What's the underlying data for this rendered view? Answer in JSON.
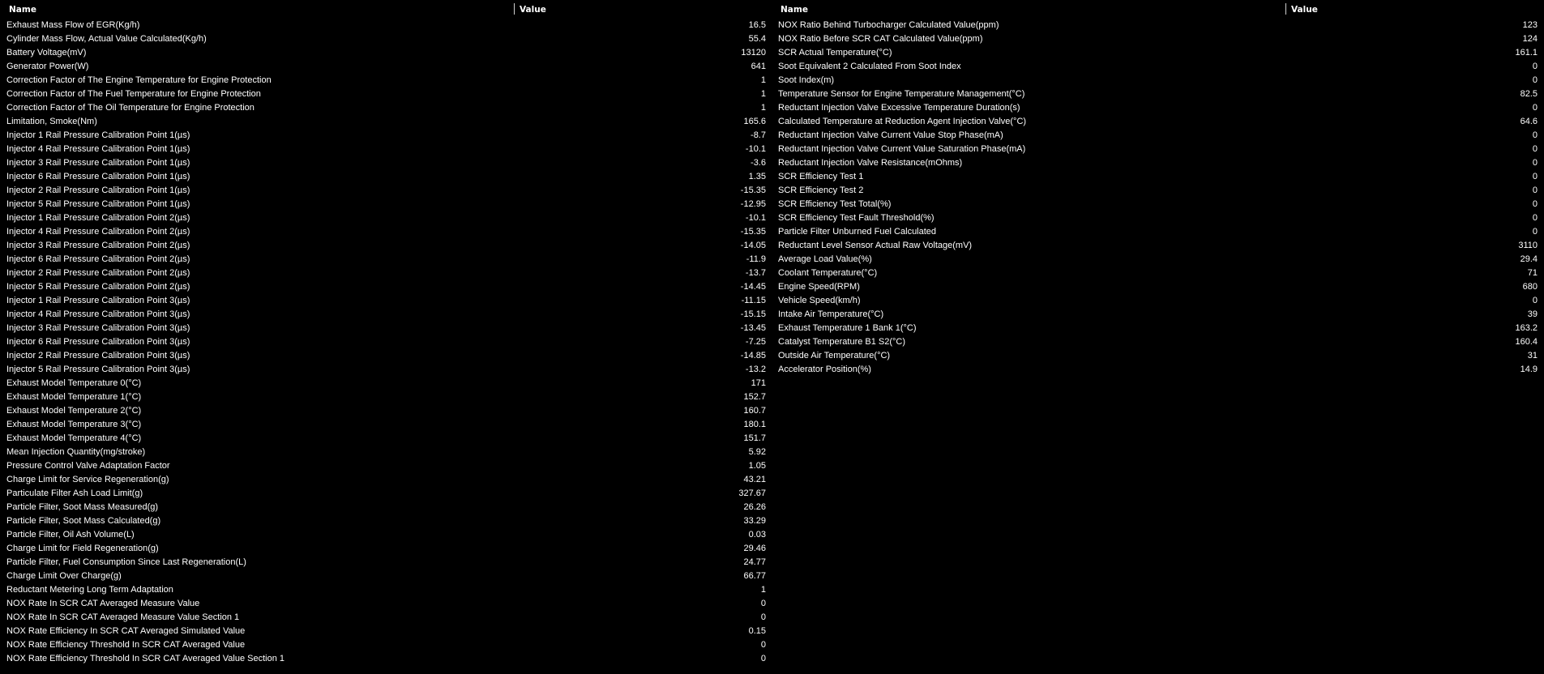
{
  "left_table": {
    "headers": {
      "name": "Name",
      "value": "Value"
    },
    "rows": [
      {
        "name": "Exhaust Mass Flow of EGR(Kg/h)",
        "value": "16.5"
      },
      {
        "name": "Cylinder Mass Flow, Actual Value Calculated(Kg/h)",
        "value": "55.4"
      },
      {
        "name": "Battery Voltage(mV)",
        "value": "13120"
      },
      {
        "name": "Generator Power(W)",
        "value": "641"
      },
      {
        "name": "Correction Factor of The Engine Temperature for Engine Protection",
        "value": "1"
      },
      {
        "name": "Correction Factor of The Fuel Temperature for Engine Protection",
        "value": "1"
      },
      {
        "name": "Correction Factor of The Oil Temperature for Engine Protection",
        "value": "1"
      },
      {
        "name": "Limitation, Smoke(Nm)",
        "value": "165.6"
      },
      {
        "name": "Injector 1 Rail Pressure Calibration Point 1(µs)",
        "value": "-8.7"
      },
      {
        "name": "Injector 4 Rail Pressure Calibration Point 1(µs)",
        "value": "-10.1"
      },
      {
        "name": "Injector 3 Rail Pressure Calibration Point 1(µs)",
        "value": "-3.6"
      },
      {
        "name": "Injector 6 Rail Pressure Calibration Point 1(µs)",
        "value": "1.35"
      },
      {
        "name": "Injector 2 Rail Pressure Calibration Point 1(µs)",
        "value": "-15.35"
      },
      {
        "name": "Injector 5 Rail Pressure Calibration Point 1(µs)",
        "value": "-12.95"
      },
      {
        "name": "Injector 1 Rail Pressure Calibration Point 2(µs)",
        "value": "-10.1"
      },
      {
        "name": "Injector 4 Rail Pressure Calibration Point 2(µs)",
        "value": "-15.35"
      },
      {
        "name": "Injector 3 Rail Pressure Calibration Point 2(µs)",
        "value": "-14.05"
      },
      {
        "name": "Injector 6 Rail Pressure Calibration Point 2(µs)",
        "value": "-11.9"
      },
      {
        "name": "Injector 2 Rail Pressure Calibration Point 2(µs)",
        "value": "-13.7"
      },
      {
        "name": "Injector 5 Rail Pressure Calibration Point 2(µs)",
        "value": "-14.45"
      },
      {
        "name": "Injector 1 Rail Pressure Calibration Point 3(µs)",
        "value": "-11.15"
      },
      {
        "name": "Injector 4 Rail Pressure Calibration Point 3(µs)",
        "value": "-15.15"
      },
      {
        "name": "Injector 3 Rail Pressure Calibration Point 3(µs)",
        "value": "-13.45"
      },
      {
        "name": "Injector 6 Rail Pressure Calibration Point 3(µs)",
        "value": "-7.25"
      },
      {
        "name": "Injector 2 Rail Pressure Calibration Point 3(µs)",
        "value": "-14.85"
      },
      {
        "name": "Injector 5 Rail Pressure Calibration Point 3(µs)",
        "value": "-13.2"
      },
      {
        "name": "Exhaust Model Temperature 0(°C)",
        "value": "171"
      },
      {
        "name": "Exhaust Model Temperature 1(°C)",
        "value": "152.7"
      },
      {
        "name": "Exhaust Model Temperature 2(°C)",
        "value": "160.7"
      },
      {
        "name": "Exhaust Model Temperature 3(°C)",
        "value": "180.1"
      },
      {
        "name": "Exhaust Model Temperature 4(°C)",
        "value": "151.7"
      },
      {
        "name": "Mean Injection Quantity(mg/stroke)",
        "value": "5.92"
      },
      {
        "name": "Pressure Control Valve Adaptation Factor",
        "value": "1.05"
      },
      {
        "name": "Charge Limit for Service Regeneration(g)",
        "value": "43.21"
      },
      {
        "name": "Particulate Filter Ash Load Limit(g)",
        "value": "327.67"
      },
      {
        "name": "Particle Filter, Soot Mass Measured(g)",
        "value": "26.26"
      },
      {
        "name": "Particle Filter, Soot Mass Calculated(g)",
        "value": "33.29"
      },
      {
        "name": "Particle Filter, Oil Ash Volume(L)",
        "value": "0.03"
      },
      {
        "name": "Charge Limit for Field Regeneration(g)",
        "value": "29.46"
      },
      {
        "name": "Particle Filter, Fuel Consumption Since Last Regeneration(L)",
        "value": "24.77"
      },
      {
        "name": "Charge Limit Over Charge(g)",
        "value": "66.77"
      },
      {
        "name": "Reductant Metering Long Term Adaptation",
        "value": "1"
      },
      {
        "name": "NOX Rate In SCR CAT Averaged Measure Value",
        "value": "0"
      },
      {
        "name": "NOX Rate In SCR CAT Averaged Measure Value Section 1",
        "value": "0"
      },
      {
        "name": "NOX Rate Efficiency In SCR CAT Averaged Simulated Value",
        "value": "0.15"
      },
      {
        "name": "NOX Rate Efficiency Threshold In SCR CAT Averaged Value",
        "value": "0"
      },
      {
        "name": "NOX Rate Efficiency Threshold In SCR CAT Averaged Value Section 1",
        "value": "0"
      }
    ]
  },
  "right_table": {
    "headers": {
      "name": "Name",
      "value": "Value"
    },
    "rows": [
      {
        "name": "NOX Ratio Behind Turbocharger Calculated Value(ppm)",
        "value": "123"
      },
      {
        "name": "NOX Ratio Before SCR CAT Calculated Value(ppm)",
        "value": "124"
      },
      {
        "name": "SCR Actual Temperature(°C)",
        "value": "161.1"
      },
      {
        "name": "Soot Equivalent 2 Calculated From Soot Index",
        "value": "0"
      },
      {
        "name": "Soot Index(m)",
        "value": "0"
      },
      {
        "name": "Temperature Sensor for Engine Temperature Management(°C)",
        "value": "82.5"
      },
      {
        "name": "Reductant Injection Valve Excessive Temperature Duration(s)",
        "value": "0"
      },
      {
        "name": "Calculated Temperature at Reduction Agent Injection Valve(°C)",
        "value": "64.6"
      },
      {
        "name": "Reductant Injection Valve Current Value Stop Phase(mA)",
        "value": "0"
      },
      {
        "name": "Reductant Injection Valve Current Value Saturation Phase(mA)",
        "value": "0"
      },
      {
        "name": "Reductant Injection Valve Resistance(mOhms)",
        "value": "0"
      },
      {
        "name": "SCR Efficiency Test 1",
        "value": "0"
      },
      {
        "name": "SCR Efficiency Test 2",
        "value": "0"
      },
      {
        "name": "SCR Efficiency Test Total(%)",
        "value": "0"
      },
      {
        "name": "SCR Efficiency Test Fault Threshold(%)",
        "value": "0"
      },
      {
        "name": "Particle Filter Unburned Fuel Calculated",
        "value": "0"
      },
      {
        "name": "Reductant Level Sensor Actual Raw Voltage(mV)",
        "value": "3110"
      },
      {
        "name": "Average Load Value(%)",
        "value": "29.4"
      },
      {
        "name": "Coolant Temperature(°C)",
        "value": "71"
      },
      {
        "name": "Engine Speed(RPM)",
        "value": "680"
      },
      {
        "name": "Vehicle Speed(km/h)",
        "value": "0"
      },
      {
        "name": "Intake Air Temperature(°C)",
        "value": "39"
      },
      {
        "name": "Exhaust Temperature 1 Bank 1(°C)",
        "value": "163.2"
      },
      {
        "name": "Catalyst Temperature B1 S2(°C)",
        "value": "160.4"
      },
      {
        "name": "Outside Air Temperature(°C)",
        "value": "31"
      },
      {
        "name": "Accelerator Position(%)",
        "value": "14.9"
      }
    ]
  }
}
